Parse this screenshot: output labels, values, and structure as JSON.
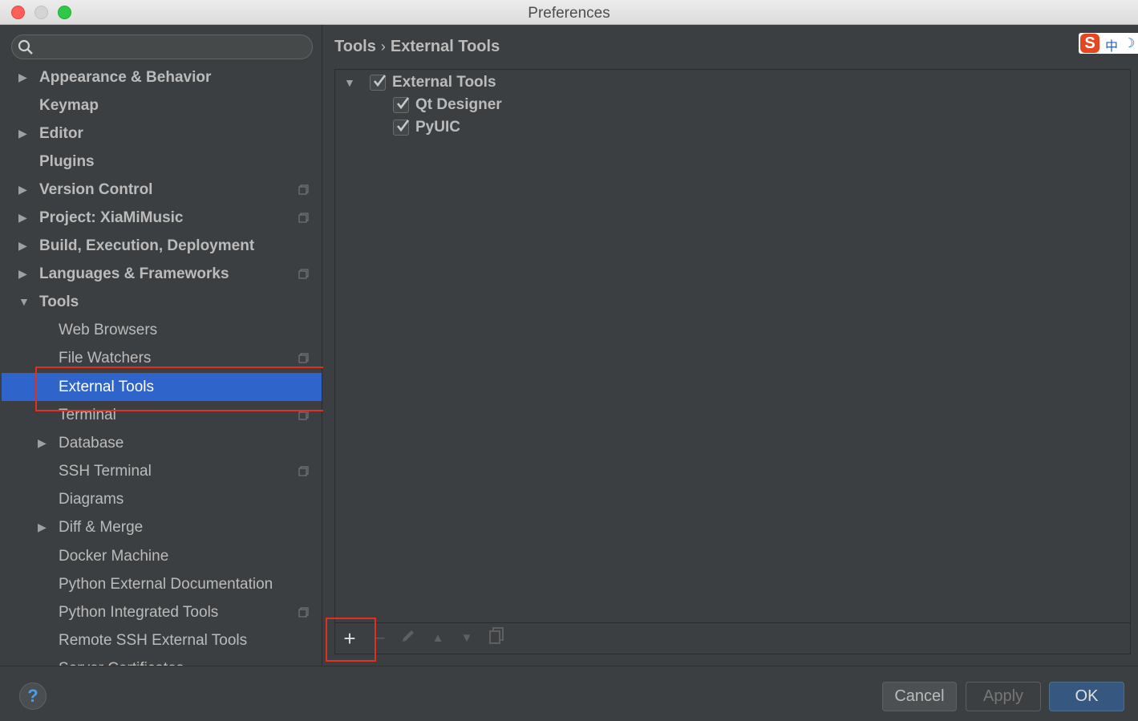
{
  "window": {
    "title": "Preferences"
  },
  "sidebar": {
    "search": {
      "placeholder": ""
    },
    "items": [
      {
        "label": "Appearance & Behavior",
        "arrow": "▶"
      },
      {
        "label": "Keymap",
        "arrow": ""
      },
      {
        "label": "Editor",
        "arrow": "▶"
      },
      {
        "label": "Plugins",
        "arrow": ""
      },
      {
        "label": "Version Control",
        "arrow": "▶"
      },
      {
        "label": "Project: XiaMiMusic",
        "arrow": "▶"
      },
      {
        "label": "Build, Execution, Deployment",
        "arrow": "▶"
      },
      {
        "label": "Languages & Frameworks",
        "arrow": "▶"
      },
      {
        "label": "Tools",
        "arrow": "▼"
      },
      {
        "label": "Web Browsers",
        "arrow": ""
      },
      {
        "label": "File Watchers",
        "arrow": ""
      },
      {
        "label": "External Tools",
        "arrow": ""
      },
      {
        "label": "Terminal",
        "arrow": ""
      },
      {
        "label": "Database",
        "arrow": "▶"
      },
      {
        "label": "SSH Terminal",
        "arrow": ""
      },
      {
        "label": "Diagrams",
        "arrow": ""
      },
      {
        "label": "Diff & Merge",
        "arrow": "▶"
      },
      {
        "label": "Docker Machine",
        "arrow": ""
      },
      {
        "label": "Python External Documentation",
        "arrow": ""
      },
      {
        "label": "Python Integrated Tools",
        "arrow": ""
      },
      {
        "label": "Remote SSH External Tools",
        "arrow": ""
      },
      {
        "label": "Server Certificates",
        "arrow": ""
      }
    ],
    "selected": "External Tools"
  },
  "main": {
    "breadcrumb": {
      "parent": "Tools",
      "separator": "›",
      "current": "External Tools"
    },
    "ime": {
      "logo": "S",
      "lang": "中",
      "mode": "☽"
    },
    "tree": {
      "group": {
        "label": "External Tools",
        "checked": true,
        "arrow": "▼"
      },
      "children": [
        {
          "label": "Qt Designer",
          "checked": true
        },
        {
          "label": "PyUIC",
          "checked": true
        }
      ]
    },
    "toolbar": {
      "add": "+",
      "remove": "−",
      "edit_icon": "pencil-icon",
      "up": "▲",
      "down": "▼",
      "copy_icon": "copy-icon"
    }
  },
  "footer": {
    "help": "?",
    "cancel": "Cancel",
    "apply": "Apply",
    "ok": "OK"
  },
  "colors": {
    "selection": "#2f65ca",
    "background": "#3c3f41",
    "annotation_box": "#e0301e",
    "ok_button": "#365880"
  }
}
